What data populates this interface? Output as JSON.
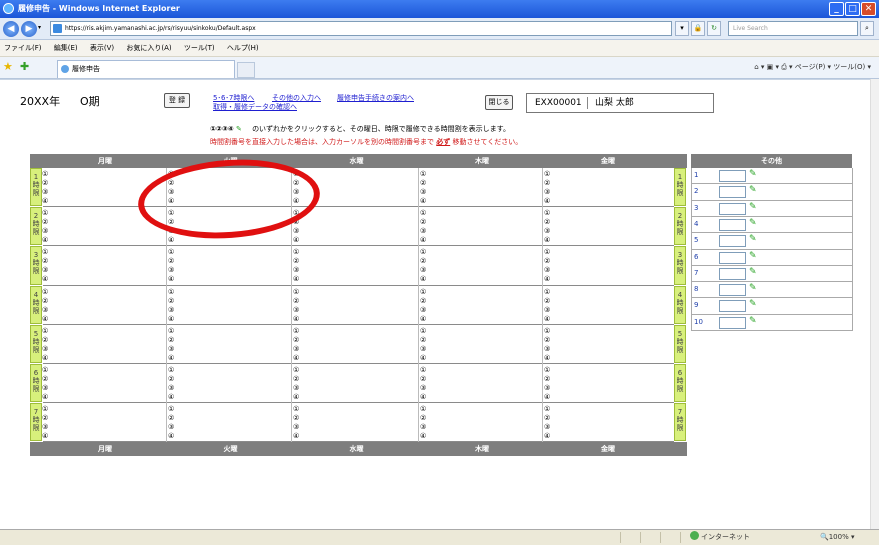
{
  "browser": {
    "title": "履修申告 - Windows Internet Explorer",
    "url": "https://ris.akjim.yamanashi.ac.jp/rs/risyuu/sinkoku/Default.aspx",
    "search_placeholder": "Live Search",
    "menu": [
      "ファイル(F)",
      "編集(E)",
      "表示(V)",
      "お気に入り(A)",
      "ツール(T)",
      "ヘルプ(H)"
    ],
    "tab_title": "履修申告",
    "tools": "ページ(P) ▾  ツール(O) ▾",
    "status_zone": "インターネット",
    "zoom": "100%",
    "accent": "#1b56d8"
  },
  "page": {
    "year": "20XX年",
    "term": "O期",
    "register_label": "登 録",
    "links": {
      "period567": "5･6･7時限へ",
      "other_input": "その他の入力へ",
      "procedure": "履修申告手続きの案内へ",
      "confirm": "取得・履修データの確認へ"
    },
    "close_label": "閉じる",
    "user_id": "EXX00001",
    "user_name": "山梨 太郎",
    "instruction_marks": "①②③④",
    "instruction_pen": "✎",
    "instruction_text": "のいずれかをクリックすると、その曜日、時限で履修できる時間割を表示します。",
    "warning_before": "時間割番号を直接入力した場合は、入力カーソルを別の時間割番号まで",
    "warning_must": "必ず",
    "warning_after": "移動させてください。"
  },
  "timetable": {
    "days": [
      "月曜",
      "火曜",
      "水曜",
      "木曜",
      "金曜"
    ],
    "period_labels": [
      "1時限",
      "2時限",
      "3時限",
      "4時限",
      "5時限",
      "6時限",
      "7時限"
    ],
    "slot_marks": [
      "①",
      "②",
      "③",
      "④"
    ],
    "header_color": "#7e7e7e",
    "period_color": "#d8f07c"
  },
  "other": {
    "header": "その他",
    "numbers": [
      "1",
      "2",
      "3",
      "4",
      "5",
      "6",
      "7",
      "8",
      "9",
      "10"
    ],
    "pen_icon": "pencil-icon"
  }
}
